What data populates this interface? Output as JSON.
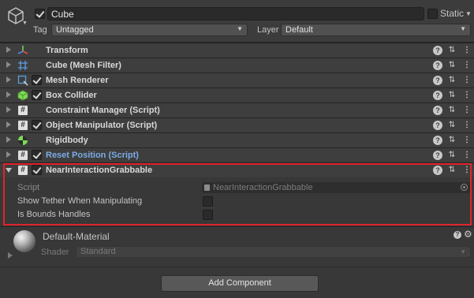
{
  "gameobject": {
    "name": "Cube",
    "active": true,
    "static_label": "Static",
    "static_checked": false,
    "tag_label": "Tag",
    "tag_value": "Untagged",
    "layer_label": "Layer",
    "layer_value": "Default"
  },
  "components": [
    {
      "name": "Transform",
      "icon": "transform-icon",
      "has_checkbox": false,
      "checked": false,
      "expanded": false
    },
    {
      "name": "Cube (Mesh Filter)",
      "icon": "mesh-filter-icon",
      "has_checkbox": false,
      "checked": false,
      "expanded": false
    },
    {
      "name": "Mesh Renderer",
      "icon": "mesh-renderer-icon",
      "has_checkbox": true,
      "checked": true,
      "expanded": false
    },
    {
      "name": "Box Collider",
      "icon": "box-collider-icon",
      "has_checkbox": true,
      "checked": true,
      "expanded": false
    },
    {
      "name": "Constraint Manager (Script)",
      "icon": "script-icon",
      "has_checkbox": false,
      "checked": false,
      "expanded": false
    },
    {
      "name": "Object Manipulator (Script)",
      "icon": "script-icon",
      "has_checkbox": true,
      "checked": true,
      "expanded": false
    },
    {
      "name": "Rigidbody",
      "icon": "rigidbody-icon",
      "has_checkbox": false,
      "checked": false,
      "expanded": false
    },
    {
      "name": "Reset Position (Script)",
      "icon": "script-icon",
      "has_checkbox": true,
      "checked": true,
      "expanded": false,
      "name_color": "#7cabe6"
    },
    {
      "name": "NearInteractionGrabbable",
      "icon": "script-icon",
      "has_checkbox": true,
      "checked": true,
      "expanded": true
    }
  ],
  "script_fields": {
    "script_label": "Script",
    "script_value": "NearInteractionGrabbable",
    "show_tether_label": "Show Tether When Manipulating",
    "show_tether_checked": false,
    "bounds_label": "Is Bounds Handles",
    "bounds_checked": false
  },
  "material": {
    "name": "Default-Material",
    "shader_label": "Shader",
    "shader_value": "Standard"
  },
  "add_component_label": "Add Component",
  "colors": {
    "highlight": "#e1232b",
    "panel_bg": "#383838",
    "link_blue": "#7cabe6"
  }
}
